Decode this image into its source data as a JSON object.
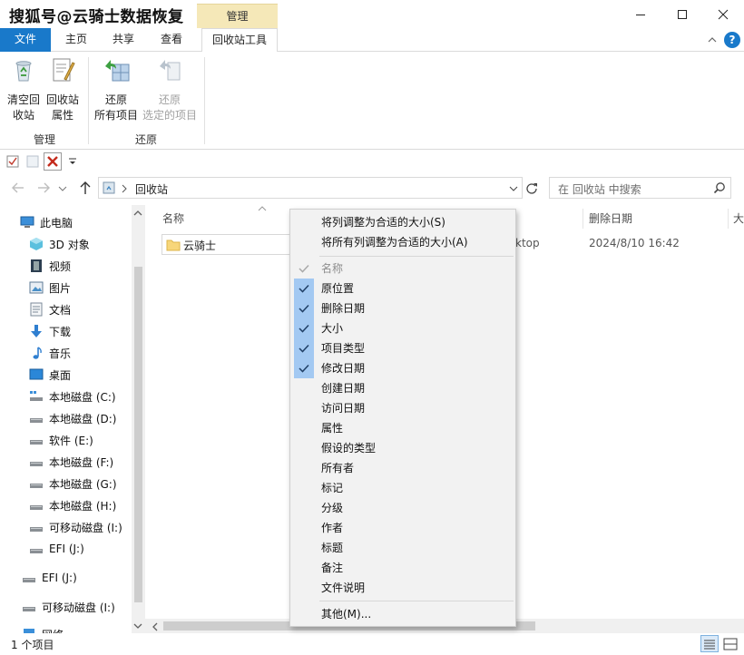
{
  "window": {
    "title": "搜狐号@云骑士数据恢复",
    "context_tab": "管理"
  },
  "ribbon_tabs": [
    "文件",
    "主页",
    "共享",
    "查看",
    "回收站工具"
  ],
  "ribbon": {
    "empty_bin": [
      "清空回",
      "收站"
    ],
    "bin_props": [
      "回收站",
      "属性"
    ],
    "restore_all": [
      "还原",
      "所有项目"
    ],
    "restore_selected": [
      "还原",
      "选定的项目"
    ],
    "group_manage": "管理",
    "group_restore": "还原"
  },
  "address": {
    "location": "回收站",
    "search_placeholder": "在 回收站 中搜索"
  },
  "nav": [
    "此电脑",
    "3D 对象",
    "视频",
    "图片",
    "文档",
    "下载",
    "音乐",
    "桌面",
    "本地磁盘 (C:)",
    "本地磁盘 (D:)",
    "软件 (E:)",
    "本地磁盘 (F:)",
    "本地磁盘 (G:)",
    "本地磁盘 (H:)",
    "可移动磁盘 (I:)",
    "EFI (J:)",
    "EFI (J:)",
    "可移动磁盘 (I:)",
    "网络"
  ],
  "columns": {
    "name": "名称",
    "deleted_date": "删除日期",
    "size": "大"
  },
  "file": {
    "name": "云骑士",
    "location_partial": "ktop",
    "deleted_date": "2024/8/10 16:42"
  },
  "status": {
    "count": "1 个项目"
  },
  "context_menu": {
    "top": [
      "将列调整为合适的大小(S)",
      "将所有列调整为合适的大小(A)"
    ],
    "columns": [
      {
        "label": "名称",
        "checked": true,
        "disabled": true
      },
      {
        "label": "原位置",
        "checked": true
      },
      {
        "label": "删除日期",
        "checked": true
      },
      {
        "label": "大小",
        "checked": true
      },
      {
        "label": "项目类型",
        "checked": true
      },
      {
        "label": "修改日期",
        "checked": true
      },
      {
        "label": "创建日期",
        "checked": false
      },
      {
        "label": "访问日期",
        "checked": false
      },
      {
        "label": "属性",
        "checked": false
      },
      {
        "label": "假设的类型",
        "checked": false
      },
      {
        "label": "所有者",
        "checked": false
      },
      {
        "label": "标记",
        "checked": false
      },
      {
        "label": "分级",
        "checked": false
      },
      {
        "label": "作者",
        "checked": false
      },
      {
        "label": "标题",
        "checked": false
      },
      {
        "label": "备注",
        "checked": false
      },
      {
        "label": "文件说明",
        "checked": false
      }
    ],
    "more": "其他(M)..."
  },
  "colors": {
    "accent": "#1979ca",
    "context_tab": "#f5e8b8",
    "menu_check_bg": "#a3c9f2",
    "close_x": "#c42b1c"
  }
}
